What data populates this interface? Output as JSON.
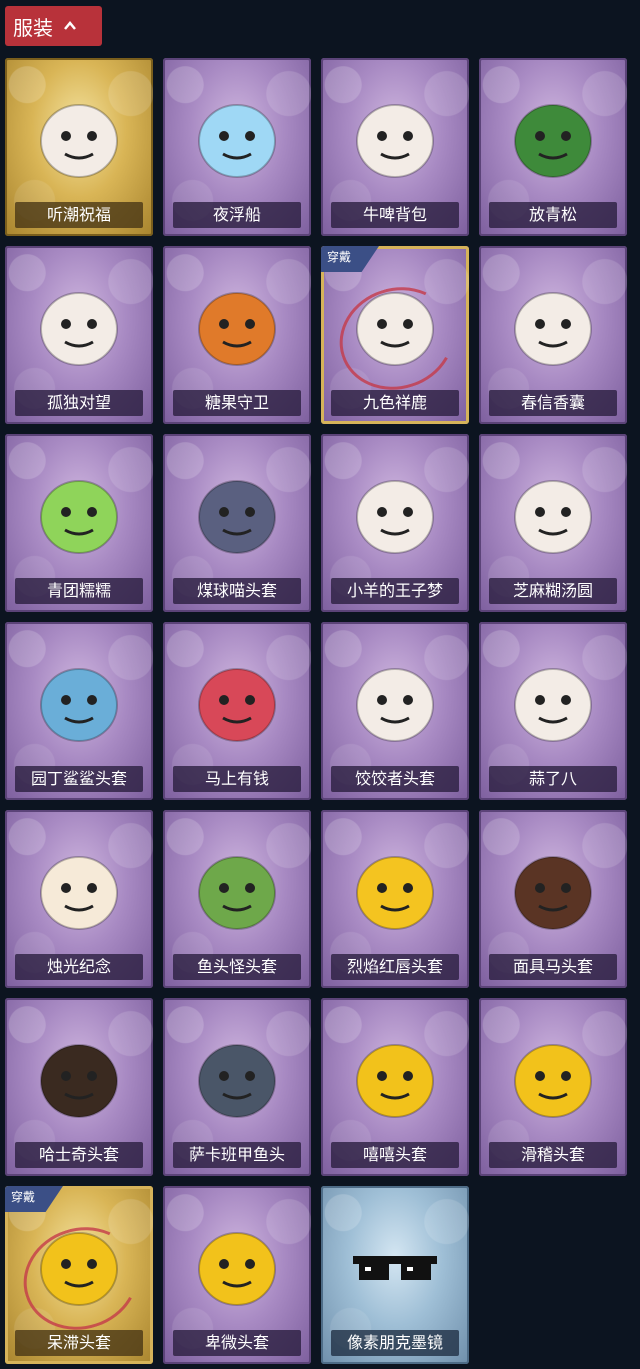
{
  "header": {
    "title": "服装"
  },
  "worn_badge": "穿戴",
  "items": [
    {
      "name": "听潮祝福",
      "theme": "gold",
      "icon": "mannequin-wings-icon",
      "worn": false
    },
    {
      "name": "夜浮船",
      "theme": "purple",
      "icon": "jellyfish-icon",
      "worn": false
    },
    {
      "name": "牛啤背包",
      "theme": "purple",
      "icon": "cow-barrel-icon",
      "worn": false
    },
    {
      "name": "放青松",
      "theme": "purple",
      "icon": "bonsai-tree-icon",
      "worn": false
    },
    {
      "name": "孤独对望",
      "theme": "purple",
      "icon": "doll-charm-icon",
      "worn": false
    },
    {
      "name": "糖果守卫",
      "theme": "purple",
      "icon": "pumpkin-charm-icon",
      "worn": false
    },
    {
      "name": "九色祥鹿",
      "theme": "purple",
      "icon": "deer-charm-icon",
      "worn": true
    },
    {
      "name": "春信香囊",
      "theme": "purple",
      "icon": "sachet-icon",
      "worn": false
    },
    {
      "name": "青团糯糯",
      "theme": "purple",
      "icon": "green-dumpling-icon",
      "worn": false
    },
    {
      "name": "煤球喵头套",
      "theme": "purple",
      "icon": "cat-head-icon",
      "worn": false
    },
    {
      "name": "小羊的王子梦",
      "theme": "purple",
      "icon": "sheep-crown-icon",
      "worn": false
    },
    {
      "name": "芝麻糊汤圆",
      "theme": "purple",
      "icon": "rice-ball-icon",
      "worn": false
    },
    {
      "name": "园丁鲨鲨头套",
      "theme": "purple",
      "icon": "shark-head-icon",
      "worn": false
    },
    {
      "name": "马上有钱",
      "theme": "purple",
      "icon": "red-horse-icon",
      "worn": false
    },
    {
      "name": "饺饺者头套",
      "theme": "purple",
      "icon": "dumpling-head-icon",
      "worn": false
    },
    {
      "name": "蒜了八",
      "theme": "purple",
      "icon": "garlic-head-icon",
      "worn": false
    },
    {
      "name": "烛光纪念",
      "theme": "purple",
      "icon": "candle-head-icon",
      "worn": false
    },
    {
      "name": "鱼头怪头套",
      "theme": "purple",
      "icon": "fish-head-icon",
      "worn": false
    },
    {
      "name": "烈焰红唇头套",
      "theme": "purple",
      "icon": "pikachu-mask-icon",
      "worn": false
    },
    {
      "name": "面具马头套",
      "theme": "purple",
      "icon": "horse-mask-icon",
      "worn": false
    },
    {
      "name": "哈士奇头套",
      "theme": "purple",
      "icon": "husky-head-icon",
      "worn": false
    },
    {
      "name": "萨卡班甲鱼头",
      "theme": "purple",
      "icon": "sacabambaspis-head-icon",
      "worn": false
    },
    {
      "name": "嘻嘻头套",
      "theme": "purple",
      "icon": "grin-emoji-icon",
      "worn": false
    },
    {
      "name": "滑稽头套",
      "theme": "purple",
      "icon": "smirk-emoji-icon",
      "worn": false
    },
    {
      "name": "呆滞头套",
      "theme": "gold",
      "icon": "stare-emoji-icon",
      "worn": true
    },
    {
      "name": "卑微头套",
      "theme": "purple",
      "icon": "humble-emoji-icon",
      "worn": false
    },
    {
      "name": "像素朋克墨镜",
      "theme": "blue",
      "icon": "pixel-sunglasses-icon",
      "worn": false
    }
  ]
}
